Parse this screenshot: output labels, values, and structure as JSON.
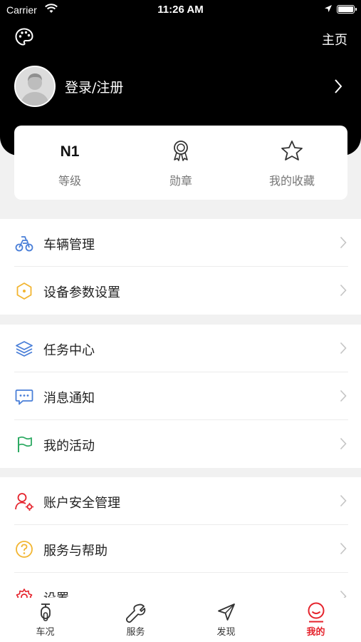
{
  "status_bar": {
    "carrier": "Carrier",
    "time": "11:26 AM"
  },
  "header": {
    "home_label": "主页",
    "login_label": "登录/注册"
  },
  "stats": [
    {
      "value": "N1",
      "label": "等级"
    },
    {
      "icon": "medal-icon",
      "label": "勋章"
    },
    {
      "icon": "star-icon",
      "label": "我的收藏"
    }
  ],
  "sections": [
    {
      "items": [
        {
          "icon": "vehicle-icon",
          "label": "车辆管理"
        },
        {
          "icon": "device-hex-icon",
          "label": "设备参数设置"
        }
      ]
    },
    {
      "items": [
        {
          "icon": "layers-icon",
          "label": "任务中心"
        },
        {
          "icon": "message-icon",
          "label": "消息通知"
        },
        {
          "icon": "flag-icon",
          "label": "我的活动"
        }
      ]
    },
    {
      "items": [
        {
          "icon": "user-gear-icon",
          "label": "账户安全管理"
        },
        {
          "icon": "help-icon",
          "label": "服务与帮助"
        },
        {
          "icon": "settings-icon",
          "label": "设置"
        }
      ]
    }
  ],
  "tabs": [
    {
      "icon": "scooter-icon",
      "label": "车况"
    },
    {
      "icon": "wrench-icon",
      "label": "服务"
    },
    {
      "icon": "navigate-icon",
      "label": "发现"
    },
    {
      "icon": "profile-icon",
      "label": "我的",
      "active": true
    }
  ],
  "colors": {
    "header_bg": "#000000",
    "accent_red": "#e5232c",
    "icon_blue": "#4a7fd8",
    "icon_yellow": "#f2b531",
    "icon_green": "#2daa63",
    "icon_red": "#e5232c"
  }
}
